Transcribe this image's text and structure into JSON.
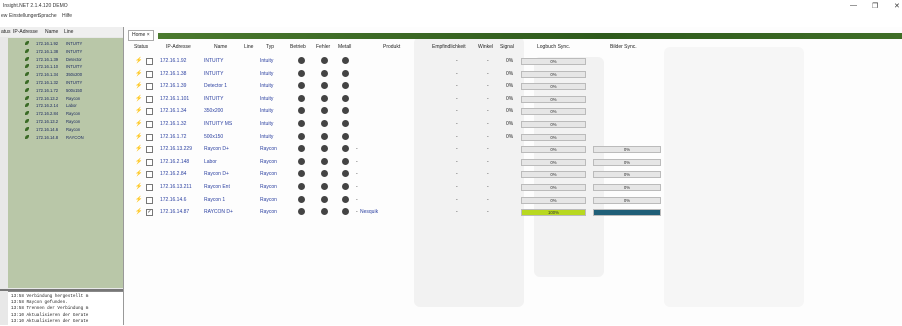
{
  "window": {
    "title": "Insight.NET 2.1.4.120 DEMO",
    "minimize": "—",
    "maximize": "❐",
    "close": "✕"
  },
  "menu": [
    "ew",
    "Einstellungen",
    "Sprache",
    "Hilfe"
  ],
  "sidebar": {
    "headers": [
      "atus",
      "IP-Adresse",
      "Name",
      "Line"
    ],
    "items": [
      {
        "ip": "172.16.1.92",
        "name": "INTUITY"
      },
      {
        "ip": "172.16.1.38",
        "name": "INTUITY"
      },
      {
        "ip": "172.16.1.39",
        "name": "Detector"
      },
      {
        "ip": "172.16.1.10",
        "name": "INTUITY"
      },
      {
        "ip": "172.16.1.34",
        "name": "350x200"
      },
      {
        "ip": "172.16.1.32",
        "name": "INTUITY"
      },
      {
        "ip": "172.16.1.72",
        "name": "500x150"
      },
      {
        "ip": "172.16.13.2",
        "name": "Raycon"
      },
      {
        "ip": "172.16.2.14",
        "name": "Labor"
      },
      {
        "ip": "172.16.2.84",
        "name": "Raycon"
      },
      {
        "ip": "172.16.13.2",
        "name": "Raycon"
      },
      {
        "ip": "172.16.14.6",
        "name": "Raycon"
      },
      {
        "ip": "172.16.14.8",
        "name": "RAYCON"
      }
    ]
  },
  "log": [
    "13:58  Verbindung hergestellt m",
    "13:58  Raycon gefunden.",
    "13:58  Trennen der Verbindung m",
    "13:10  Aktualisieren der Gerate",
    "13:10  Aktualisieren der Gerate"
  ],
  "tab": {
    "label": "Home",
    "close": "×"
  },
  "columns": {
    "status": "Status",
    "ip": "IP-Adresse",
    "name": "Name",
    "line": "Line",
    "typ": "Typ",
    "betrieb": "Betrieb",
    "fehler": "Fehler",
    "metall": "Metall",
    "produkt": "Produkt",
    "empf": "Empfindlichkeit",
    "winkel": "Winkel",
    "signal": "Signal",
    "logbuch": "Logbuch Sync.",
    "bilder": "Bilder Sync."
  },
  "rows": [
    {
      "checked": false,
      "ip": "172.16.1.92",
      "name": "INTUITY",
      "typ": "Intuity",
      "dash": "",
      "produkt": "",
      "empf": "-",
      "winkel": "-",
      "signal": "0%",
      "logbuch": "0%",
      "logbuch_pct": 0,
      "bilder": "",
      "bilder_pct": null,
      "bilder_color": ""
    },
    {
      "checked": false,
      "ip": "172.16.1.38",
      "name": "INTUITY",
      "typ": "Intuity",
      "dash": "",
      "produkt": "",
      "empf": "-",
      "winkel": "-",
      "signal": "0%",
      "logbuch": "0%",
      "logbuch_pct": 0,
      "bilder": "",
      "bilder_pct": null,
      "bilder_color": ""
    },
    {
      "checked": false,
      "ip": "172.16.1.39",
      "name": "Detector 1",
      "typ": "Intuity",
      "dash": "",
      "produkt": "",
      "empf": "-",
      "winkel": "-",
      "signal": "0%",
      "logbuch": "0%",
      "logbuch_pct": 0,
      "bilder": "",
      "bilder_pct": null,
      "bilder_color": ""
    },
    {
      "checked": false,
      "ip": "172.16.1.101",
      "name": "INTUITY",
      "typ": "Intuity",
      "dash": "",
      "produkt": "",
      "empf": "-",
      "winkel": "-",
      "signal": "0%",
      "logbuch": "0%",
      "logbuch_pct": 0,
      "bilder": "",
      "bilder_pct": null,
      "bilder_color": ""
    },
    {
      "checked": false,
      "ip": "172.16.1.34",
      "name": "350x200",
      "typ": "Intuity",
      "dash": "",
      "produkt": "",
      "empf": "-",
      "winkel": "-",
      "signal": "0%",
      "logbuch": "0%",
      "logbuch_pct": 0,
      "bilder": "",
      "bilder_pct": null,
      "bilder_color": ""
    },
    {
      "checked": false,
      "ip": "172.16.1.32",
      "name": "INTUITY MS",
      "typ": "Intuity",
      "dash": "",
      "produkt": "",
      "empf": "-",
      "winkel": "-",
      "signal": "0%",
      "logbuch": "0%",
      "logbuch_pct": 0,
      "bilder": "",
      "bilder_pct": null,
      "bilder_color": ""
    },
    {
      "checked": false,
      "ip": "172.16.1.72",
      "name": "500x150",
      "typ": "Intuity",
      "dash": "",
      "produkt": "",
      "empf": "-",
      "winkel": "-",
      "signal": "0%",
      "logbuch": "0%",
      "logbuch_pct": 0,
      "bilder": "",
      "bilder_pct": null,
      "bilder_color": ""
    },
    {
      "checked": false,
      "ip": "172.16.13.229",
      "name": "Raycon D+",
      "typ": "Raycon",
      "dash": "-",
      "produkt": "",
      "empf": "-",
      "winkel": "-",
      "signal": "",
      "logbuch": "0%",
      "logbuch_pct": 0,
      "bilder": "0%",
      "bilder_pct": 0,
      "bilder_color": ""
    },
    {
      "checked": false,
      "ip": "172.16.2.148",
      "name": "Labor",
      "typ": "Raycon",
      "dash": "-",
      "produkt": "",
      "empf": "-",
      "winkel": "-",
      "signal": "",
      "logbuch": "0%",
      "logbuch_pct": 0,
      "bilder": "0%",
      "bilder_pct": 0,
      "bilder_color": ""
    },
    {
      "checked": false,
      "ip": "172.16.2.84",
      "name": "Raycon D+",
      "typ": "Raycon",
      "dash": "-",
      "produkt": "",
      "empf": "-",
      "winkel": "-",
      "signal": "",
      "logbuch": "0%",
      "logbuch_pct": 0,
      "bilder": "0%",
      "bilder_pct": 0,
      "bilder_color": ""
    },
    {
      "checked": false,
      "ip": "172.16.13.211",
      "name": "Raycon Ent",
      "typ": "Raycon",
      "dash": "-",
      "produkt": "",
      "empf": "-",
      "winkel": "-",
      "signal": "",
      "logbuch": "0%",
      "logbuch_pct": 0,
      "bilder": "0%",
      "bilder_pct": 0,
      "bilder_color": ""
    },
    {
      "checked": false,
      "ip": "172.16.14.6",
      "name": "Raycon 1",
      "typ": "Raycon",
      "dash": "-",
      "produkt": "",
      "empf": "-",
      "winkel": "-",
      "signal": "",
      "logbuch": "0%",
      "logbuch_pct": 0,
      "bilder": "0%",
      "bilder_pct": 0,
      "bilder_color": ""
    },
    {
      "checked": true,
      "ip": "172.16.14.87",
      "name": "RAYCON D+",
      "typ": "Raycon",
      "dash": "-",
      "produkt": "Nesquik",
      "empf": "-",
      "winkel": "-",
      "signal": "",
      "logbuch": "100%",
      "logbuch_pct": 100,
      "bilder": "",
      "bilder_pct": 100,
      "bilder_color": "#1f5f78"
    }
  ],
  "colors": {
    "accent_green": "#3a6a25",
    "progress_lime": "#b8d820",
    "link_blue": "#2a3fa0"
  },
  "icons": {
    "plug": "plug-icon",
    "leaf": "leaf-icon"
  }
}
